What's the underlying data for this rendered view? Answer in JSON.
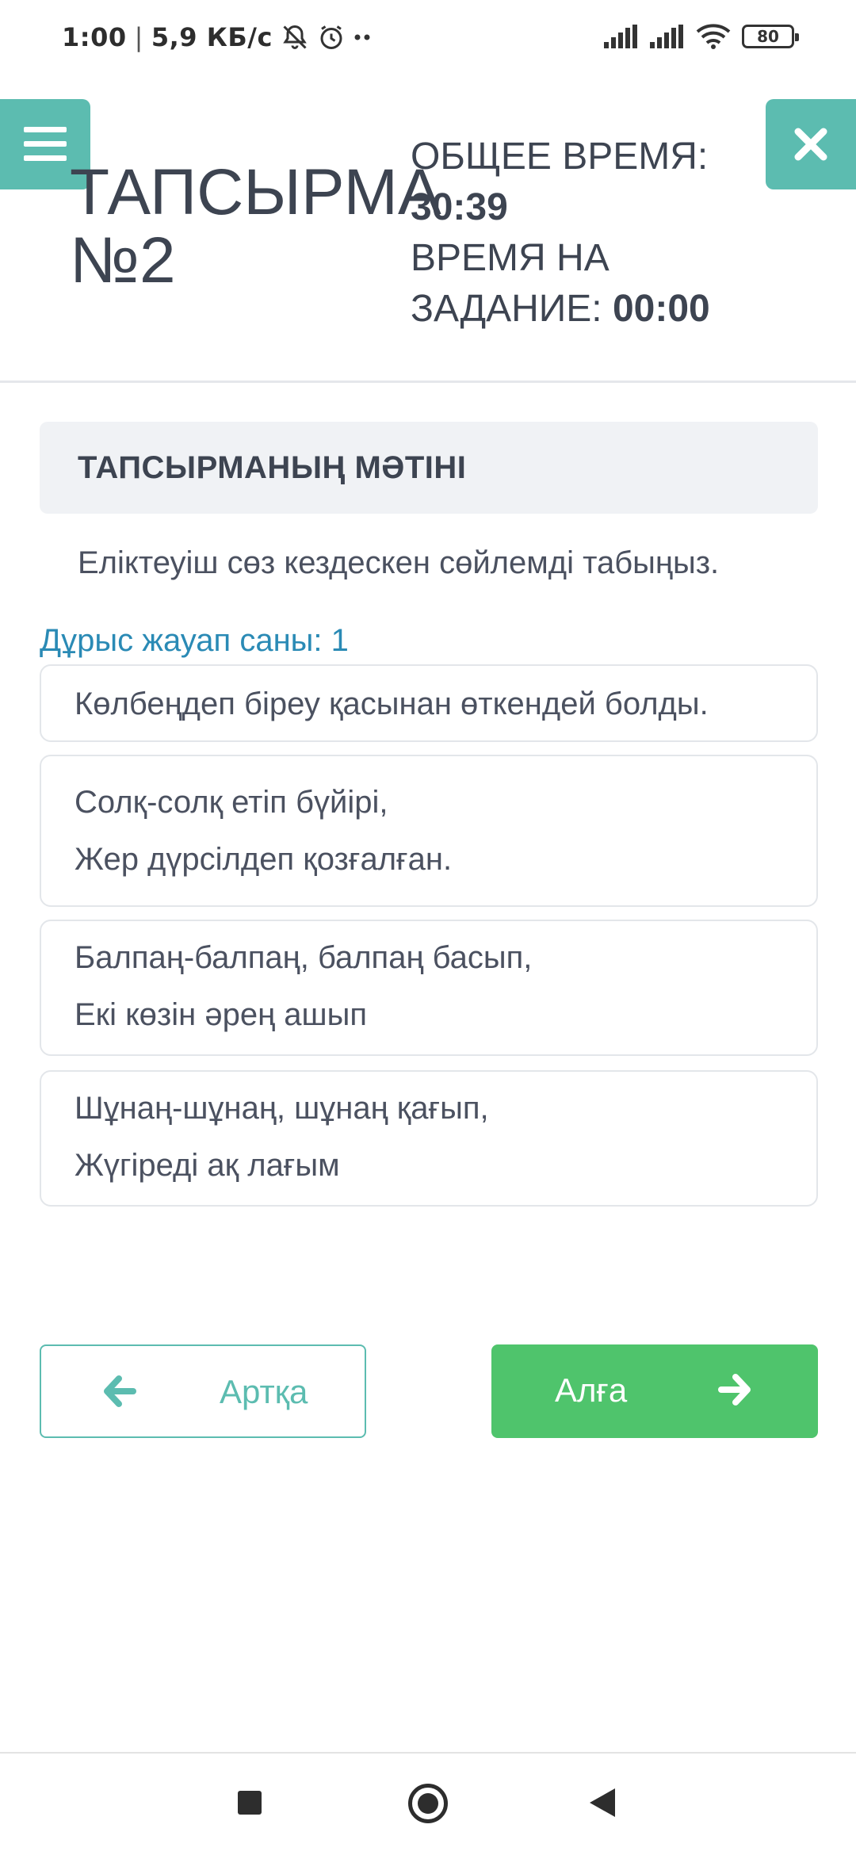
{
  "status_bar": {
    "time": "1:00",
    "speed": "5,9 КБ/с",
    "battery": "80"
  },
  "header": {
    "task_title_line1": "ТАПСЫРМА",
    "task_title_line2": "№2",
    "total_time_label": "ОБЩЕЕ ВРЕМЯ:",
    "total_time_value": "30:39",
    "task_time_label_1": "ВРЕМЯ НА",
    "task_time_label_2": "ЗАДАНИЕ:",
    "task_time_value": "00:00"
  },
  "task": {
    "section_title": "ТАПСЫРМАНЫҢ МӘТІНІ",
    "question": "Еліктеуіш сөз кездескен сөйлемді табыңыз.",
    "answer_count": "Дұрыс жауап саны: 1"
  },
  "options": [
    {
      "lines": [
        "Көлбеңдеп біреу қасынан өткендей болды."
      ]
    },
    {
      "lines": [
        "Солқ-солқ етіп бүйірі,",
        "Жер дүрсілдеп қозғалған."
      ]
    },
    {
      "lines": [
        "Балпаң-балпаң, балпаң басып,",
        "Екі көзін әрең ашып"
      ]
    },
    {
      "lines": [
        "Шұнаң-шұнаң, шұнаң қағып,",
        "Жүгіреді ақ лағым"
      ]
    }
  ],
  "navigation": {
    "back_label": "Артқа",
    "next_label": "Алға"
  },
  "colors": {
    "accent_teal": "#5cbcb0",
    "next_green": "#4fc46c",
    "answer_count_blue": "#2a8ab5"
  },
  "icons": {
    "menu": "hamburger-icon",
    "close": "close-icon",
    "back": "arrow-left-icon",
    "next": "arrow-right-icon"
  }
}
